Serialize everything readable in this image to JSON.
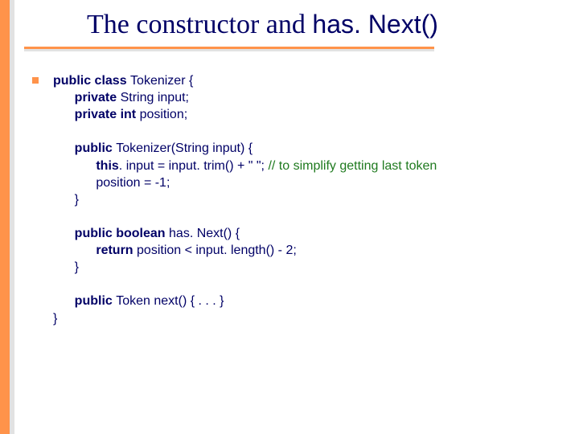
{
  "title": {
    "prefix": "The constructor and ",
    "mono": "has. Next()"
  },
  "code": {
    "l1a": "public class ",
    "l1b": "Tokenizer {",
    "l2a": "private ",
    "l2b": "String input;",
    "l3a": "private int ",
    "l3b": "position;",
    "l5a": "public ",
    "l5b": "Tokenizer(String input) {",
    "l6a": "this",
    "l6b": ". input = input. trim() + \" \"; ",
    "l6c": "// to simplify getting last token",
    "l7": "position = -1;",
    "l8": "}",
    "l10a": "public boolean ",
    "l10b": "has. Next() {",
    "l11a": "return ",
    "l11b": "position < input. length() - 2;",
    "l12": "}",
    "l14a": "public ",
    "l14b": "Token next() { . . . }",
    "l15": "}"
  }
}
